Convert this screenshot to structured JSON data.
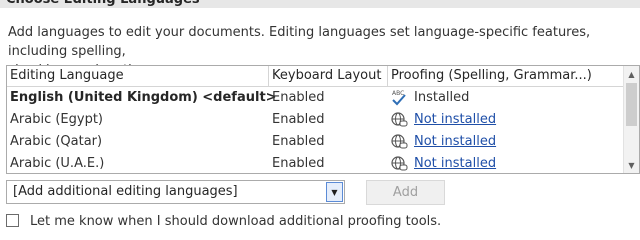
{
  "section": {
    "title": "Choose Editing Languages"
  },
  "description": {
    "line1": "Add languages to edit your documents. Editing languages set language-specific features, including spelling,",
    "line2": "checking, and sorting."
  },
  "table": {
    "headers": [
      "Editing Language",
      "Keyboard Layout",
      "Proofing (Spelling, Grammar...)"
    ],
    "rows": [
      {
        "language": "English (United Kingdom) <default>",
        "keyboard": "Enabled",
        "proofing": "Installed",
        "proofing_icon": "spellcheck-abc-icon",
        "is_default": true
      },
      {
        "language": "Arabic (Egypt)",
        "keyboard": "Enabled",
        "proofing": "Not installed",
        "proofing_icon": "globe-link-icon",
        "is_default": false
      },
      {
        "language": "Arabic (Qatar)",
        "keyboard": "Enabled",
        "proofing": "Not installed",
        "proofing_icon": "globe-link-icon",
        "is_default": false
      },
      {
        "language": "Arabic (U.A.E.)",
        "keyboard": "Enabled",
        "proofing": "Not installed",
        "proofing_icon": "globe-link-icon",
        "is_default": false
      }
    ],
    "scroll_up_icon": "triangle-up-icon",
    "scroll_down_icon": "triangle-down-icon"
  },
  "add_language": {
    "selected": "[Add additional editing languages]",
    "dropdown_icon": "triangle-down-icon",
    "button_label": "Add",
    "button_enabled": false
  },
  "notify": {
    "label": "Let me know when I should download additional proofing tools.",
    "checked": false
  },
  "colors": {
    "link": "#1f4fa8",
    "title_bar": "#e7e7e7",
    "check_accent": "#2f6fb6"
  }
}
